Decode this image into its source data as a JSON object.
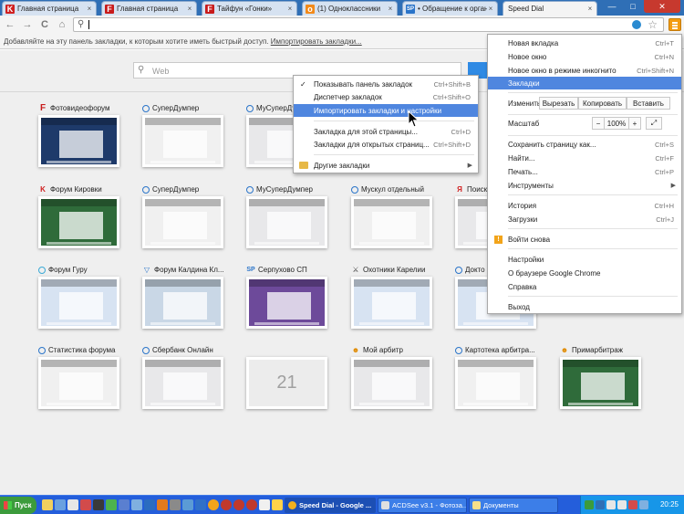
{
  "tabs": [
    {
      "label": "Главная страница",
      "icon": "K",
      "icon_kind": "k"
    },
    {
      "label": "Главная страница",
      "icon": "F",
      "icon_kind": "f"
    },
    {
      "label": "Тайфун «Гонки»",
      "icon": "F",
      "icon_kind": "f"
    },
    {
      "label": "(1) Одноклассники",
      "icon": "ok",
      "icon_kind": "ok"
    },
    {
      "label": "• Обращение к орган",
      "icon": "SP",
      "icon_kind": "sp"
    },
    {
      "label": "Speed Dial",
      "icon": "",
      "icon_kind": "none"
    }
  ],
  "window": {
    "minimize": "—",
    "maximize": "□",
    "close": "✕"
  },
  "toolbar": {
    "back": "←",
    "forward": "→",
    "reload": "C",
    "home": "⌂",
    "search_icon": "⚲",
    "star": "☆"
  },
  "bookmarks_bar": {
    "text": "Добавляйте на эту панель закладки, к которым хотите иметь быстрый доступ.",
    "link": "Импортировать закладки..."
  },
  "speed_dial": {
    "search_placeholder": "Web",
    "dials": [
      {
        "title": "Фотовидеофорум",
        "icon": "F",
        "kind": "f",
        "thumb": "th-dark"
      },
      {
        "title": "СуперДумпер",
        "icon": "",
        "kind": "c",
        "thumb": "th-grey"
      },
      {
        "title": "МуСуперДумпер",
        "icon": "",
        "kind": "c",
        "thumb": "th-light"
      },
      {
        "title": "Форум Кировки",
        "icon": "K",
        "kind": "k",
        "thumb": "th-green"
      },
      {
        "title": "СуперДумпер",
        "icon": "",
        "kind": "c",
        "thumb": "th-grey"
      },
      {
        "title": "МуСуперДумпер",
        "icon": "",
        "kind": "c",
        "thumb": "th-light"
      },
      {
        "title": "Мускул отдельный",
        "icon": "",
        "kind": "c",
        "thumb": "th-grey"
      },
      {
        "title": "Поиск",
        "icon": "Я",
        "kind": "ya",
        "thumb": "th-light"
      },
      {
        "title": "Форум Гуру",
        "icon": "",
        "kind": "g",
        "thumb": "th-blue"
      },
      {
        "title": "Форум Калдина Кл...",
        "icon": "▽",
        "kind": "v",
        "thumb": "th-mixed"
      },
      {
        "title": "Серпухово СП",
        "icon": "SP",
        "kind": "sp",
        "thumb": "th-purple"
      },
      {
        "title": "Охотники Карелии",
        "icon": "⚔",
        "kind": "gun",
        "thumb": "th-blue"
      },
      {
        "title": "Докто",
        "icon": "",
        "kind": "c",
        "thumb": "th-blue"
      },
      {
        "title": "Статистика форума",
        "icon": "",
        "kind": "c",
        "thumb": "th-grey"
      },
      {
        "title": "Сбербанк Онлайн",
        "icon": "",
        "kind": "c",
        "thumb": "th-light"
      },
      {
        "title": "",
        "icon": "",
        "kind": "none",
        "thumb": "empty",
        "number": "21"
      },
      {
        "title": "Мой арбитр",
        "icon": "☻",
        "kind": "arb",
        "thumb": "th-light"
      },
      {
        "title": "Картотека арбитра...",
        "icon": "",
        "kind": "c",
        "thumb": "th-grey"
      },
      {
        "title": "Примарбитраж",
        "icon": "☻",
        "kind": "arb",
        "thumb": "th-green"
      }
    ]
  },
  "bookmarks_menu": {
    "items": [
      {
        "label": "Показывать панель закладок",
        "shortcut": "Ctrl+Shift+B",
        "checked": "✓"
      },
      {
        "label": "Диспетчер закладок",
        "shortcut": "Ctrl+Shift+O"
      },
      {
        "label": "Импортировать закладки и настройки",
        "shortcut": ""
      },
      {
        "label": "Закладка для этой страницы...",
        "shortcut": "Ctrl+D"
      },
      {
        "label": "Закладки для открытых страниц...",
        "shortcut": "Ctrl+Shift+D"
      },
      {
        "label": "Другие закладки",
        "shortcut": ""
      }
    ]
  },
  "chrome_menu": {
    "items": [
      {
        "label": "Новая вкладка",
        "shortcut": "Ctrl+T"
      },
      {
        "label": "Новое окно",
        "shortcut": "Ctrl+N"
      },
      {
        "label": "Новое окно в режиме инкогнито",
        "shortcut": "Ctrl+Shift+N"
      },
      {
        "label": "Закладки",
        "shortcut": ""
      },
      {
        "label": "Изменить",
        "shortcut": ""
      },
      {
        "label": "Масштаб",
        "shortcut": ""
      },
      {
        "label": "Сохранить страницу как...",
        "shortcut": "Ctrl+S"
      },
      {
        "label": "Найти...",
        "shortcut": "Ctrl+F"
      },
      {
        "label": "Печать...",
        "shortcut": "Ctrl+P"
      },
      {
        "label": "Инструменты",
        "shortcut": ""
      },
      {
        "label": "История",
        "shortcut": "Ctrl+H"
      },
      {
        "label": "Загрузки",
        "shortcut": "Ctrl+J"
      },
      {
        "label": "Войти снова",
        "shortcut": ""
      },
      {
        "label": "Настройки",
        "shortcut": ""
      },
      {
        "label": "О браузере Google Chrome",
        "shortcut": ""
      },
      {
        "label": "Справка",
        "shortcut": ""
      },
      {
        "label": "Выход",
        "shortcut": ""
      }
    ],
    "edit_buttons": {
      "cut": "Вырезать",
      "copy": "Копировать",
      "paste": "Вставить"
    },
    "zoom": {
      "minus": "−",
      "value": "100%",
      "plus": "+",
      "fullscreen": "⤢"
    }
  },
  "taskbar": {
    "start": "Пуск",
    "tasks": [
      {
        "label": "Speed Dial - Google ..."
      },
      {
        "label": "ACDSee v3.1 - Фотоза..."
      },
      {
        "label": "Документы"
      }
    ],
    "clock": "20:25"
  },
  "colors": {
    "accent": "#4f86df",
    "menu_button": "#f39c12",
    "taskbar": "#245edb"
  }
}
